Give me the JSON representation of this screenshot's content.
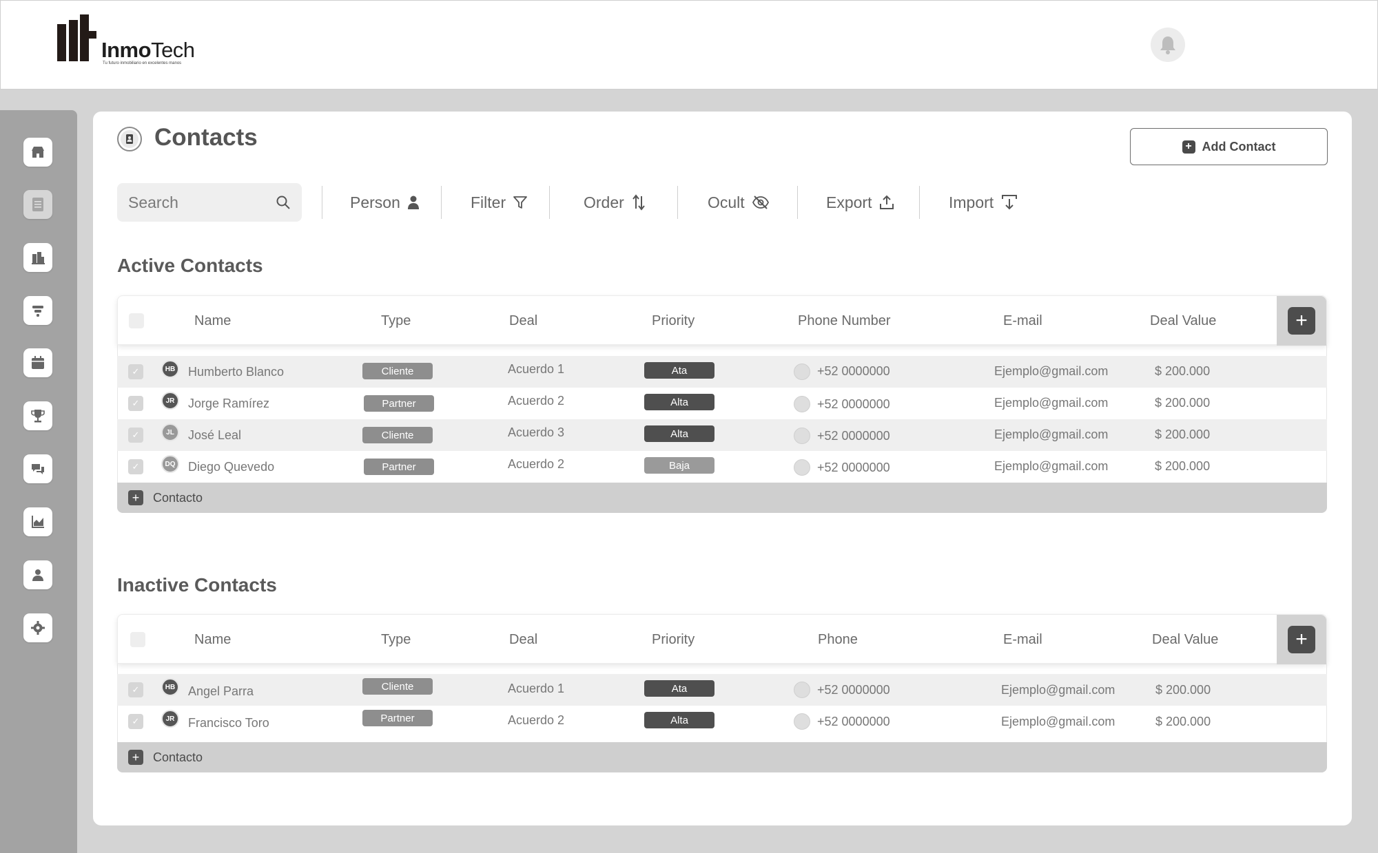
{
  "brand": {
    "name_bold": "Inmo",
    "name_light": "Tech",
    "tagline": "Tu futuro inmobiliario en excelentes manos"
  },
  "page": {
    "title": "Contacts"
  },
  "header": {
    "add_contact_label": "Add Contact"
  },
  "toolbar": {
    "search_placeholder": "Search",
    "person": "Person",
    "filter": "Filter",
    "order": "Order",
    "ocult": "Ocult",
    "export": "Export",
    "import": "Import"
  },
  "sidebar": {
    "icons": [
      "store-icon",
      "list-icon",
      "buildings-icon",
      "funnel-icon",
      "calendar-icon",
      "trophy-icon",
      "chat-icon",
      "chart-icon",
      "user-icon",
      "gear-icon"
    ],
    "active_index": 1
  },
  "active": {
    "title": "Active Contacts",
    "columns": [
      "Name",
      "Type",
      "Deal",
      "Priority",
      "Phone Number",
      "E-mail",
      "Deal Value"
    ],
    "rows": [
      {
        "initials": "HB",
        "name": "Humberto Blanco",
        "type": "Cliente",
        "deal": "Acuerdo 1",
        "priority": "Ata",
        "phone": "+52 0000000",
        "email": "Ejemplo@gmail.com",
        "value": "$ 200.000"
      },
      {
        "initials": "JR",
        "name": "Jorge Ramírez",
        "type": "Partner",
        "deal": "Acuerdo 2",
        "priority": "Alta",
        "phone": "+52 0000000",
        "email": "Ejemplo@gmail.com",
        "value": "$ 200.000"
      },
      {
        "initials": "JL",
        "name": "José Leal",
        "type": "Cliente",
        "deal": "Acuerdo 3",
        "priority": "Alta",
        "phone": "+52 0000000",
        "email": "Ejemplo@gmail.com",
        "value": "$ 200.000"
      },
      {
        "initials": "DQ",
        "name": "Diego Quevedo",
        "type": "Partner",
        "deal": "Acuerdo 2",
        "priority": "Baja",
        "phone": "+52 0000000",
        "email": "Ejemplo@gmail.com",
        "value": "$ 200.000"
      }
    ],
    "footer": "Contacto"
  },
  "inactive": {
    "title": "Inactive Contacts",
    "columns": [
      "Name",
      "Type",
      "Deal",
      "Priority",
      "Phone",
      "E-mail",
      "Deal Value"
    ],
    "rows": [
      {
        "initials": "HB",
        "name": "Angel Parra",
        "type": "Cliente",
        "deal": "Acuerdo 1",
        "priority": "Ata",
        "phone": "+52 0000000",
        "email": "Ejemplo@gmail.com",
        "value": "$ 200.000"
      },
      {
        "initials": "JR",
        "name": "Francisco Toro",
        "type": "Partner",
        "deal": "Acuerdo 2",
        "priority": "Alta",
        "phone": "+52 0000000",
        "email": "Ejemplo@gmail.com",
        "value": "$ 200.000"
      }
    ],
    "footer": "Contacto"
  },
  "colors": {
    "background": "#d4d4d4",
    "sidebar": "#a3a3a3",
    "dark_badge": "#4f4f4f",
    "light_badge": "#9a9a9a",
    "type_badge": "#8e8e8e"
  }
}
